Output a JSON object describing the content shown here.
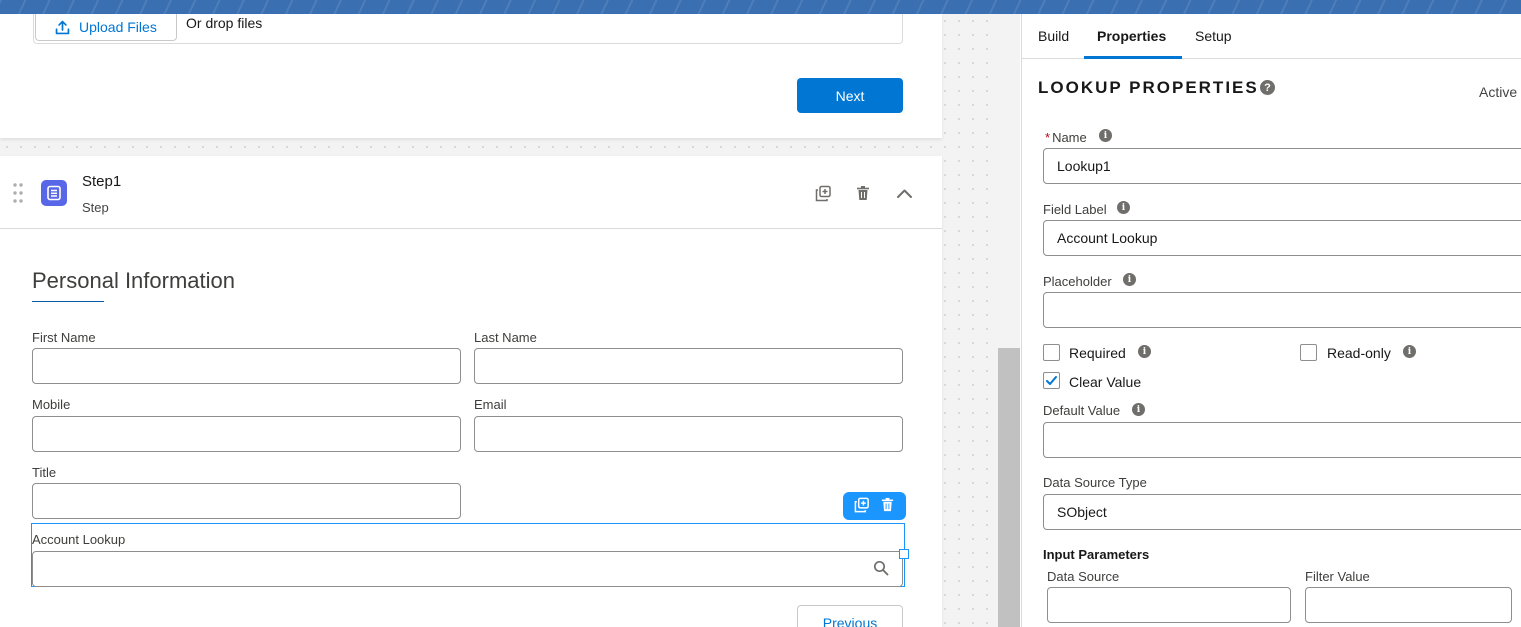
{
  "upload": {
    "button_label": "Upload Files",
    "drop_text": "Or drop files"
  },
  "nav": {
    "next_label": "Next",
    "previous_label": "Previous"
  },
  "step": {
    "title": "Step1",
    "subtitle": "Step",
    "section_title": "Personal Information"
  },
  "form": {
    "first_name_label": "First Name",
    "last_name_label": "Last Name",
    "mobile_label": "Mobile",
    "email_label": "Email",
    "title_label": "Title",
    "account_lookup_label": "Account Lookup"
  },
  "panel": {
    "tabs": [
      {
        "label": "Build"
      },
      {
        "label": "Properties"
      },
      {
        "label": "Setup"
      }
    ],
    "active_tab": "Properties",
    "title": "LOOKUP PROPERTIES",
    "status": "Active",
    "name_label": "Name",
    "name_value": "Lookup1",
    "field_label_label": "Field Label",
    "field_label_value": "Account Lookup",
    "placeholder_label": "Placeholder",
    "placeholder_value": "",
    "required_label": "Required",
    "required_checked": false,
    "readonly_label": "Read-only",
    "readonly_checked": false,
    "clear_value_label": "Clear Value",
    "clear_value_checked": true,
    "default_value_label": "Default Value",
    "default_value": "",
    "data_source_type_label": "Data Source Type",
    "data_source_type_value": "SObject",
    "input_parameters_label": "Input Parameters",
    "data_source_label": "Data Source",
    "filter_value_label": "Filter Value"
  },
  "colors": {
    "brand": "#0176d3",
    "step_icon": "#5867e8",
    "selection": "#1b96ff"
  }
}
